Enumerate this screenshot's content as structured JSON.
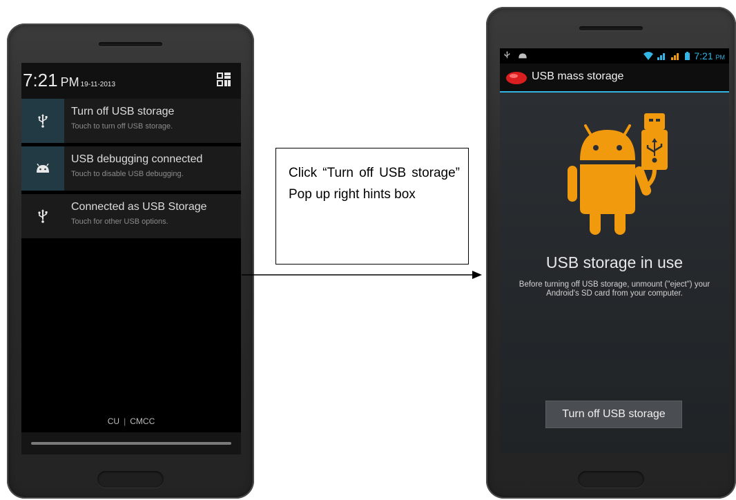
{
  "left_phone": {
    "clock": {
      "time": "7:21",
      "ampm": "PM",
      "date": "19-11-2013"
    },
    "notifications": [
      {
        "title": "Turn off USB storage",
        "subtitle": "Touch to turn off USB storage.",
        "icon": "usb-icon"
      },
      {
        "title": "USB debugging connected",
        "subtitle": "Touch to disable USB debugging.",
        "icon": "android-debug-icon"
      },
      {
        "title": "Connected as USB Storage",
        "subtitle": "Touch for other USB options.",
        "icon": "usb-icon"
      }
    ],
    "carriers": {
      "first": "CU",
      "separator": "|",
      "second": "CMCC"
    }
  },
  "callout": {
    "text": "Click “Turn off USB storage” Pop up right hints box"
  },
  "right_phone": {
    "status_bar": {
      "time": "7:21",
      "ampm": "PM"
    },
    "action_bar": {
      "title": "USB mass storage"
    },
    "heading": "USB storage in use",
    "description": "Before turning off USB storage, unmount (\"eject\") your Android's SD card from your computer.",
    "button_label": "Turn off USB storage"
  },
  "colors": {
    "accent": "#33b5e5",
    "android_orange": "#f29a0e",
    "highlight": "#223a44"
  }
}
